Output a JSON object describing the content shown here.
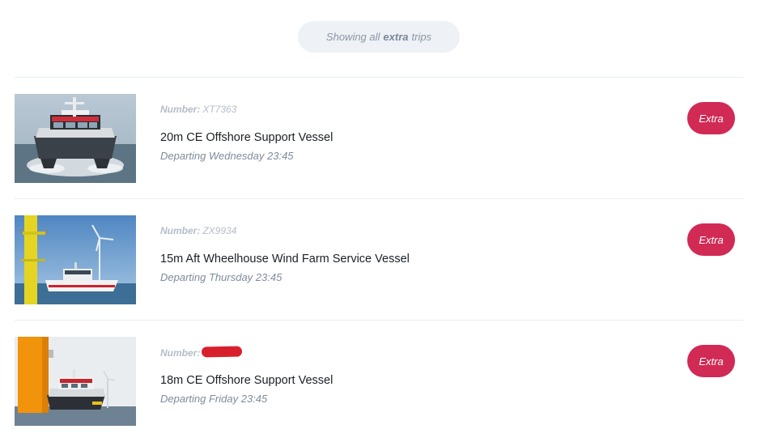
{
  "filter": {
    "prefix": "Showing all",
    "highlight": "extra",
    "suffix": "trips"
  },
  "trips": [
    {
      "number_label": "Number:",
      "number": "XT7363",
      "number_redacted": false,
      "title": "20m CE Offshore Support Vessel",
      "departure": "Departing Wednesday 23:45",
      "badge": "Extra",
      "image": "catamaran-vessel-photo"
    },
    {
      "number_label": "Number:",
      "number": "ZX9934",
      "number_redacted": false,
      "title": "15m Aft Wheelhouse Wind Farm Service Vessel",
      "departure": "Departing Thursday 23:45",
      "badge": "Extra",
      "image": "wind-farm-vessel-photo"
    },
    {
      "number_label": "Number:",
      "number": "",
      "number_redacted": true,
      "title": "18m CE Offshore Support Vessel",
      "departure": "Departing Friday 23:45",
      "badge": "Extra",
      "image": "turbine-tower-vessel-photo"
    }
  ],
  "colors": {
    "badge": "#d12a54",
    "pill_bg": "#eef1f5",
    "redaction": "#d8202d"
  }
}
